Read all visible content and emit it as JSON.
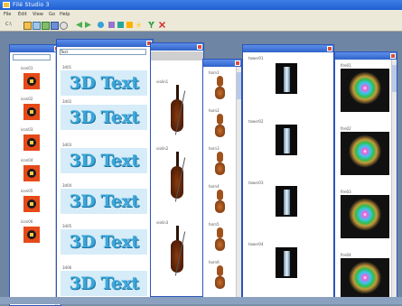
{
  "app": {
    "title": "Filé Studio 3",
    "menu": [
      "File",
      "Edit",
      "View",
      "Go",
      "Help"
    ]
  },
  "toolbar": {
    "address": "C:\\",
    "icons": [
      "folder-up-icon",
      "browse-icon",
      "tree-icon",
      "thumbnails-icon",
      "search-icon",
      "back-icon",
      "forward-icon",
      "refresh-icon",
      "filter-icon",
      "select-icon",
      "edit-icon",
      "favorite-icon",
      "accept-icon",
      "delete-icon"
    ]
  },
  "windows": [
    {
      "id": "icons",
      "title": "",
      "select": "",
      "captions": [
        "icon01",
        "icon02",
        "icon03",
        "icon04",
        "icon05",
        "icon06"
      ]
    },
    {
      "id": "text3d",
      "title": "",
      "select": "Text",
      "captions": [
        "3d01",
        "3d02",
        "3d03",
        "3d04",
        "3d05",
        "3d06"
      ],
      "text": "3D Text"
    },
    {
      "id": "violins",
      "title": "",
      "captions": [
        "violin1",
        "violin2",
        "violin3"
      ]
    },
    {
      "id": "horns",
      "title": "",
      "captions": [
        "horn1",
        "horn2",
        "horn3",
        "horn4",
        "horn5",
        "horn6"
      ]
    },
    {
      "id": "towers",
      "title": "",
      "captions": [
        "tower01",
        "tower02",
        "tower03",
        "tower04"
      ]
    },
    {
      "id": "fireworks",
      "title": "",
      "captions": [
        "fire01",
        "fire02",
        "fire03",
        "fire04"
      ]
    }
  ]
}
